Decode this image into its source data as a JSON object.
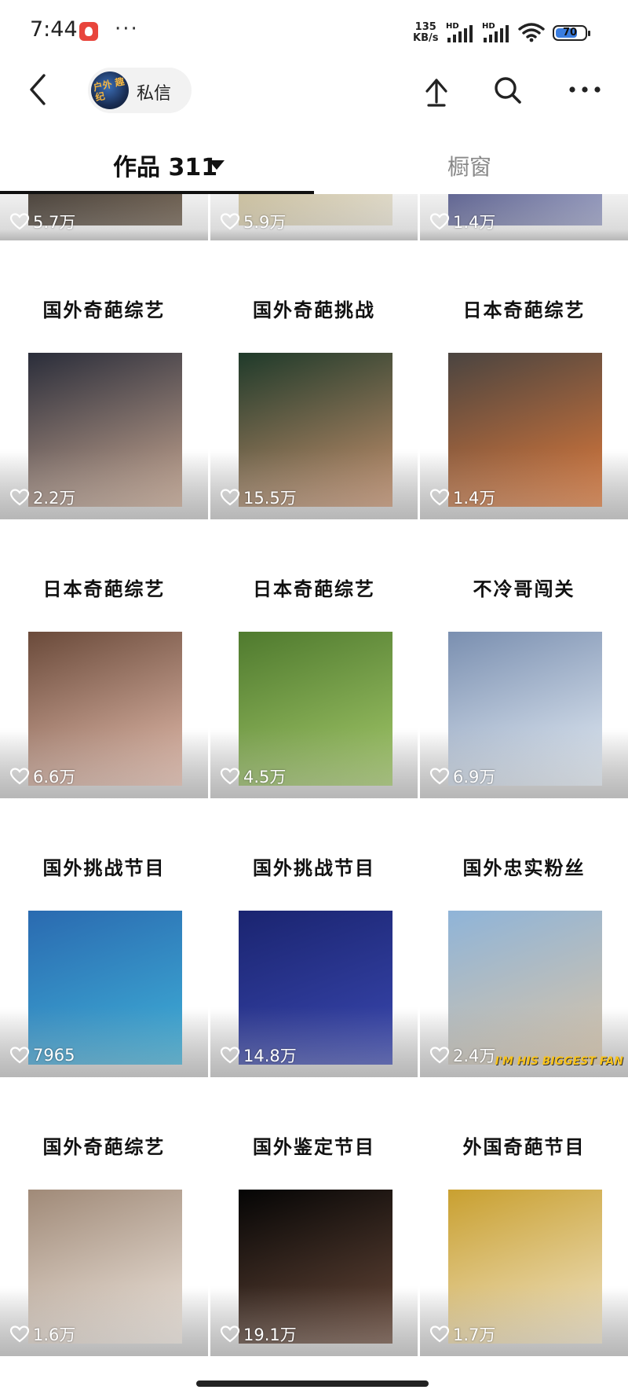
{
  "status_bar": {
    "time": "7:44",
    "more": "···",
    "net_speed_value": "135",
    "net_speed_unit": "KB/s",
    "hd_label": "HD",
    "battery_level": "70"
  },
  "header": {
    "avatar_text": "户外 趣纪",
    "message_label": "私信"
  },
  "tabs": {
    "works_label": "作品 311",
    "shop_label": "橱窗"
  },
  "grid": {
    "partial_row": [
      {
        "likes": "5.7万",
        "thumb_colors": [
          "#2b2520",
          "#6b5a48"
        ]
      },
      {
        "likes": "5.9万",
        "thumb_colors": [
          "#c9b98a",
          "#eee8d6"
        ]
      },
      {
        "likes": "1.4万",
        "thumb_colors": [
          "#3a3f7a",
          "#9aa0c8"
        ]
      }
    ],
    "items": [
      {
        "title": "国外奇葩综艺",
        "likes": "2.2万",
        "thumb_colors": [
          "#2a2d3a",
          "#c9a892"
        ]
      },
      {
        "title": "国外奇葩挑战",
        "likes": "15.5万",
        "thumb_colors": [
          "#1f3a2a",
          "#c8926e"
        ]
      },
      {
        "title": "日本奇葩综艺",
        "likes": "1.4万",
        "thumb_colors": [
          "#4a4440",
          "#e07a3a"
        ]
      },
      {
        "title": "日本奇葩综艺",
        "likes": "6.6万",
        "thumb_colors": [
          "#6a4a3a",
          "#e8c0b0"
        ]
      },
      {
        "title": "日本奇葩综艺",
        "likes": "4.5万",
        "thumb_colors": [
          "#4f7a2e",
          "#a4c96a"
        ]
      },
      {
        "title": "不冷哥闯关",
        "likes": "6.9万",
        "thumb_colors": [
          "#7a8fb0",
          "#e6eef6"
        ]
      },
      {
        "title": "国外挑战节目",
        "likes": "7965",
        "thumb_colors": [
          "#2a6ab0",
          "#3fb0d8"
        ]
      },
      {
        "title": "国外挑战节目",
        "likes": "14.8万",
        "thumb_colors": [
          "#1a2470",
          "#3a48b0"
        ]
      },
      {
        "title": "国外忠实粉丝",
        "likes": "2.4万",
        "thumb_colors": [
          "#8fb4d8",
          "#d8c4a8"
        ],
        "overlay_text": "I'M HIS BIGGEST FAN"
      },
      {
        "title": "国外奇葩综艺",
        "likes": "1.6万",
        "thumb_colors": [
          "#a08a78",
          "#f0e8e0"
        ]
      },
      {
        "title": "国外鉴定节目",
        "likes": "19.1万",
        "thumb_colors": [
          "#050505",
          "#6a4a3a"
        ]
      },
      {
        "title": "外国奇葩节目",
        "likes": "1.7万",
        "thumb_colors": [
          "#c9a030",
          "#f0e4c8"
        ]
      }
    ]
  }
}
